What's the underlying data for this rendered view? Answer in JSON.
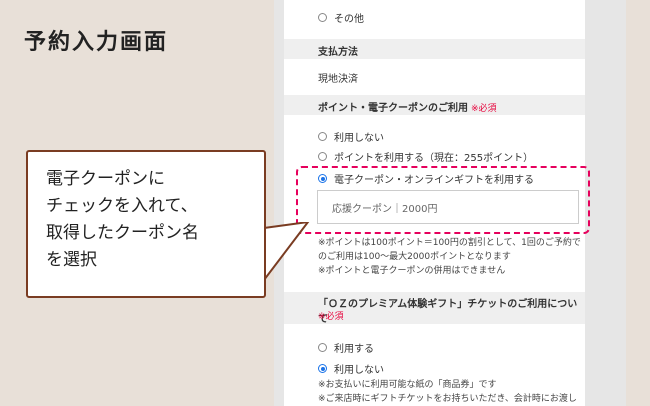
{
  "page_title": "予約入力画面",
  "form": {
    "other_option": "その他",
    "payment": {
      "label": "支払方法",
      "value": "現地決済"
    },
    "points_coupon": {
      "label": "ポイント・電子クーポンのご利用",
      "required": "※必須",
      "options": [
        "利用しない",
        "ポイントを利用する（現在：255ポイント）",
        "電子クーポン・オンラインギフトを利用する"
      ],
      "selected_index": 2,
      "coupon_value": "応援クーポン｜2000円",
      "notes": [
        "※ポイントは100ポイント＝100円の割引として、1回のご予約で",
        "のご利用は100～最大2000ポイントとなります",
        "※ポイントと電子クーポンの併用はできません"
      ]
    },
    "gift_ticket": {
      "label": "「ＯＺのプレミアム体験ギフト」チケットのご利用について",
      "required": "※必須",
      "options": [
        "利用する",
        "利用しない"
      ],
      "selected_index": 1,
      "notes": [
        "※お支払いに利用可能な紙の「商品券」です",
        "※ご来店時にギフトチケットをお持ちいただき、会計時にお渡し"
      ]
    }
  },
  "callout": {
    "lines": [
      "電子クーポンに",
      "チェックを入れて、",
      "取得したクーポン名",
      "を選択"
    ]
  },
  "colors": {
    "background": "#e8e0d8",
    "highlight": "#e6005c",
    "required": "#e6003a",
    "callout_border": "#7a3c22",
    "radio_selected": "#1a73e8"
  }
}
